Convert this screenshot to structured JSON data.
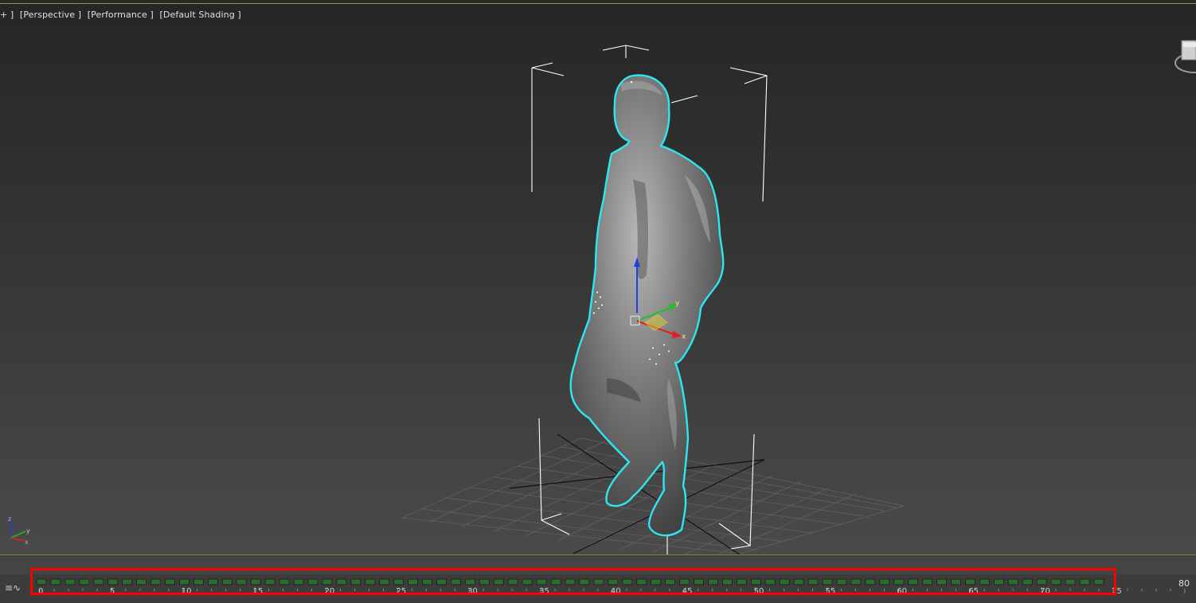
{
  "viewport": {
    "labels": [
      "+ ]",
      "[Perspective ]",
      "[Performance ]",
      "[Default Shading ]"
    ]
  },
  "gizmo_axes": {
    "x": "x",
    "y": "y",
    "z": "z"
  },
  "timeline": {
    "tick_labels": [
      "0",
      "5",
      "10",
      "15",
      "20",
      "25",
      "30",
      "35",
      "40",
      "45",
      "50",
      "55",
      "60",
      "65",
      "70",
      "75"
    ],
    "end_frame": "80",
    "key_count": 75
  },
  "colors": {
    "selection_outline": "#2ee6f0",
    "key_green": "#2e6b2e",
    "highlight_box": "#ff0000",
    "axis_x": "#e02020",
    "axis_y": "#20c020",
    "axis_z": "#2040e0"
  },
  "icons": [
    "viewcube-icon",
    "curve-editor-icon",
    "axis-tripod-icon"
  ]
}
